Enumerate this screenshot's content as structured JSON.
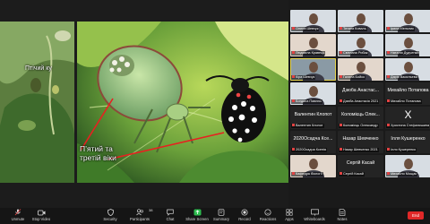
{
  "slide": {
    "label_small": "Птічий ку",
    "label_big_line1": "П’ятий та",
    "label_big_line2": "третій віки"
  },
  "gallery": [
    {
      "name": "Олена Шевчук",
      "kind": "video",
      "tone": ""
    },
    {
      "name": "Тетяна Коваль",
      "kind": "video",
      "tone": ""
    },
    {
      "name": "Ірина Мельник",
      "kind": "video",
      "tone": ""
    },
    {
      "name": "Людмила Кравець",
      "kind": "video",
      "tone": "warm"
    },
    {
      "name": "Світлана Рибак",
      "kind": "video",
      "tone": ""
    },
    {
      "name": "Наталія Дудченко",
      "kind": "video",
      "tone": ""
    },
    {
      "name": "Кіра Шевчук",
      "kind": "video",
      "tone": "dark"
    },
    {
      "name": "Галина Бойко",
      "kind": "video",
      "tone": "warm"
    },
    {
      "name": "Дарія Васильева",
      "kind": "video",
      "tone": ""
    },
    {
      "name": "Богдана Павлюк",
      "kind": "video",
      "tone": ""
    },
    {
      "name": "Дзюба Анастас",
      "kind": "text",
      "label": "Дзюба Анастас...",
      "tag": "Дзюба Анастасія 2021"
    },
    {
      "name": "Михайло Потапова",
      "kind": "text",
      "label": "Михайло Потаповa",
      "tag": "Михайло Потапова"
    },
    {
      "name": "Валентин Клопот",
      "kind": "text",
      "label": "Валентин Клопот",
      "tag": "Валентин Клопот"
    },
    {
      "name": "Коломієць Олександр",
      "kind": "text",
      "label": "Коломієць Олек...",
      "tag": "Коломієць Олександр"
    },
    {
      "name": "Христина Стефанишин",
      "kind": "letter",
      "label": "X",
      "tag": "Христина Стефанишина"
    },
    {
      "name": "2020Осадча Ксенія",
      "kind": "text",
      "label": "2020Осадча Ксе...",
      "tag": "2020Осадча Ксенія"
    },
    {
      "name": "Назар Шевченко",
      "kind": "text",
      "label": "Назар Шевченко",
      "tag": "Назар Шевченко 2021"
    },
    {
      "name": "Ілля Кушеренко",
      "kind": "text",
      "label": "Ілля Кушеренко",
      "tag": "Ілля Кушеренко"
    },
    {
      "name": "Кафедра",
      "kind": "video",
      "tone": "warm",
      "tag": "Кафедра біології"
    },
    {
      "name": "Сергій Касай",
      "kind": "text",
      "label": "Сергій Касай",
      "tag": "Сергій Касай"
    },
    {
      "name": "Михайло Мощак",
      "kind": "video",
      "tone": "",
      "tag": "Михайло Мощак"
    }
  ],
  "toolbar": {
    "unmute": "Unmute",
    "stop_video": "Stop Video",
    "security": "Security",
    "participants": "Participants",
    "participants_count": "38",
    "chat": "Chat",
    "share_screen": "Share Screen",
    "summary": "Summary",
    "record": "Record",
    "reactions": "Reactions",
    "apps": "Apps",
    "whiteboards": "Whiteboards",
    "notes": "Notes",
    "end": "End"
  },
  "colors": {
    "share_screen_green": "#2dbc4e",
    "end_red": "#e02828",
    "active_speaker": "#e8d44d"
  }
}
